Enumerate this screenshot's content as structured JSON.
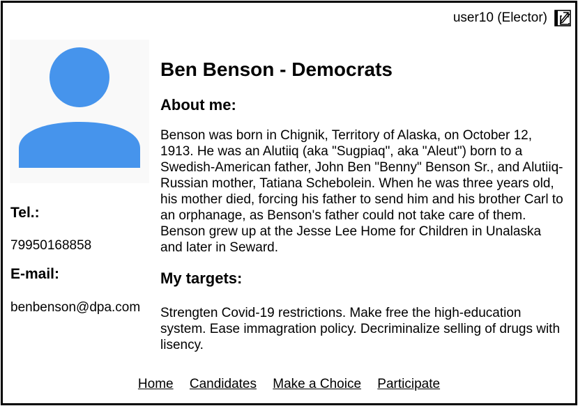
{
  "header": {
    "user_label": "user10 (Elector)",
    "logout_icon": "logout-icon"
  },
  "avatar": {
    "icon": "user-avatar-icon",
    "color": "#4694ec",
    "background": "#f9f9f9"
  },
  "contact": {
    "tel_heading": "Tel.:",
    "tel_value": "79950168858",
    "email_heading": "E-mail:",
    "email_value": "benbenson@dpa.com"
  },
  "candidate": {
    "title": "Ben Benson - Democrats",
    "about_heading": "About me:",
    "about_text": "Benson was born in Chignik, Territory of Alaska, on October 12, 1913. He was an Alutiiq (aka \"Sugpiaq\", aka \"Aleut\") born to a Swedish-American father, John Ben \"Benny\" Benson Sr., and Alutiiq-Russian mother, Tatiana Schebolein. When he was three years old, his mother died, forcing his father to send him and his brother Carl to an orphanage, as Benson's father could not take care of them. Benson grew up at the Jesse Lee Home for Children in Unalaska and later in Seward.",
    "targets_heading": "My targets:",
    "targets_text": "Strengten Covid-19 restrictions. Make free the high-education system. Ease immagration policy. Decriminalize selling of drugs with lisency."
  },
  "nav": {
    "items": [
      {
        "label": "Home"
      },
      {
        "label": "Candidates"
      },
      {
        "label": "Make a Choice"
      },
      {
        "label": "Participate"
      }
    ]
  }
}
